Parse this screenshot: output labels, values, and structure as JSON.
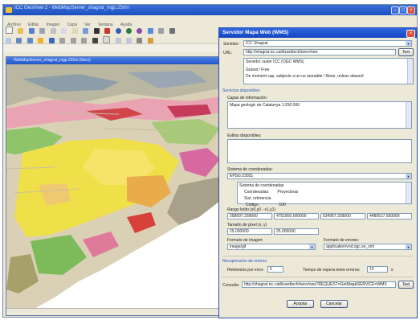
{
  "window": {
    "title": "ICC GeoView 2 - WebMapServer_shagrat_mgp.250m"
  },
  "menu": [
    "Archivo",
    "Editar",
    "Imagen",
    "Capa",
    "Ver",
    "Ventana",
    "Ayuda"
  ],
  "map_window": {
    "title": "WebMapServer_shagrat_mgp.250m (llano)",
    "status_left": "",
    "status_mid": "",
    "status_right": ""
  },
  "dialog": {
    "title": "Servidor Mapa Web (WMS)",
    "server_label": "Servidor:",
    "server_value": "ICC Shagrat",
    "url_label": "URL:",
    "url_value": "http://shagrat.icc.cat/lizardtech/iserv/ows",
    "test_button": "Test",
    "info_lines": [
      "Servidor raster ICC (OGC WMS)",
      "",
      "Gratuit / Free",
      "De moment cap, subjecte a un us raonable / None, unless abused"
    ],
    "services_section": "Servicios disponibles",
    "layers_label": "Capas de información:",
    "layer_selected": "Mapa geologic de Catalunya 1:250 000",
    "styles_label": "Estilos disponibles:",
    "crs_label": "Sistema de coordenadas:",
    "crs_value": "EPSG:23031",
    "crs_info": [
      {
        "k": "Sistema de coordenadas",
        "v": ""
      },
      {
        "k": "Coordenadas:",
        "v": "Proyectivas"
      },
      {
        "k": "Sist. referencia",
        "v": ""
      },
      {
        "k": "Código",
        "v": "100"
      }
    ],
    "range_label": "Rango leído (x0,y0 - x1,y1)",
    "range_values": [
      "258007.339000",
      "4751892.660000",
      "534957.339000",
      "4489517.660000"
    ],
    "pixel_label": "Tamaño de píxel (x, y)",
    "pixel_values": [
      "25.000000",
      "25.000000"
    ],
    "image_format_label": "Formato de imagen:",
    "image_format_value": "image/gif",
    "error_format_label": "Formato de errores:",
    "error_format_value": "application/vnd.ogc.se_xml",
    "recovery_section": "Recuperación de errores",
    "retries_label": "Reintentos por error:",
    "retries_value": "5",
    "timeout_label": "Tiempo de espera entre errores:",
    "timeout_value": "10",
    "timeout_unit": "s",
    "query_label": "Consulta:",
    "query_value": "http://shagrat.icc.cat/lizardtech/iserv/ows?REQUEST=GetMap&SERVICE=WMS",
    "query_test": "Test",
    "accept_button": "Aceptar",
    "cancel_button": "Cancelar"
  }
}
